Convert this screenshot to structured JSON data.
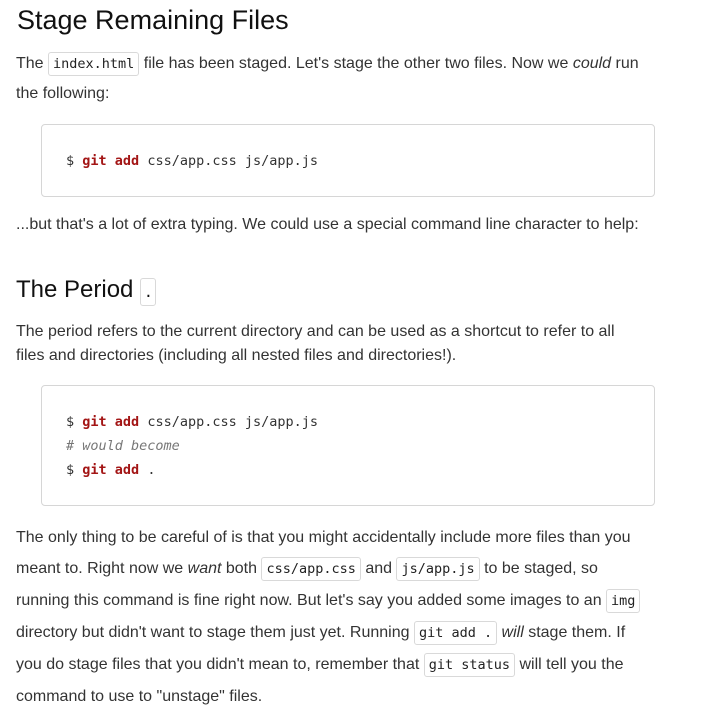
{
  "section1": {
    "title": "Stage Remaining Files",
    "para1": {
      "t1": "The ",
      "code1": "index.html",
      "t2": " file has been staged. Let's stage the other two files. Now we ",
      "em1": "could",
      "t3": " run",
      "line2": "the following:"
    },
    "code": {
      "prompt": "$",
      "cmd": "git add",
      "args": " css/app.css js/app.js"
    },
    "para2": "...but that's a lot of extra typing. We could use a special command line character to help:"
  },
  "section2": {
    "title": "The Period",
    "badge": ".",
    "para1_line1": "The period refers to the current directory and can be used as a shortcut to refer to all",
    "para1_line2": "files and directories (including all nested files and directories!).",
    "code": {
      "l1_prompt": "$",
      "l1_cmd": "git add",
      "l1_args": " css/app.css js/app.js",
      "l2_comment": "# would become",
      "l3_prompt": "$",
      "l3_cmd": "git add",
      "l3_args": " ."
    },
    "para2": {
      "l1": "The only thing to be careful of is that you might accidentally include more files than you",
      "l2a": "meant to. Right now we ",
      "l2em": "want",
      "l2b": " both ",
      "l2code1": "css/app.css",
      "l2c": " and ",
      "l2code2": "js/app.js",
      "l2d": " to be staged, so",
      "l3a": "running this command is fine right now. But let's say you added some images to an ",
      "l3code": "img",
      "l4a": "directory but didn't want to stage them just yet. Running ",
      "l4code": "git add .",
      "l4em": "will",
      "l4b": " stage them. If",
      "l5a": "you do stage files that you didn't mean to, remember that ",
      "l5code": "git status",
      "l5b": " will tell you the",
      "l6": "command to use to \"unstage\" files."
    }
  }
}
